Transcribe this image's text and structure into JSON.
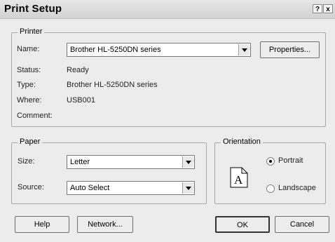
{
  "window": {
    "title": "Print Setup",
    "help_glyph": "?",
    "close_glyph": "x"
  },
  "printer": {
    "legend": "Printer",
    "name_label": "Name:",
    "name_value": "Brother HL-5250DN series",
    "properties_label": "Properties...",
    "status_label": "Status:",
    "status_value": "Ready",
    "type_label": "Type:",
    "type_value": "Brother HL-5250DN series",
    "where_label": "Where:",
    "where_value": "USB001",
    "comment_label": "Comment:",
    "comment_value": ""
  },
  "paper": {
    "legend": "Paper",
    "size_label": "Size:",
    "size_value": "Letter",
    "source_label": "Source:",
    "source_value": "Auto Select"
  },
  "orientation": {
    "legend": "Orientation",
    "page_glyph": "A",
    "portrait_label": "Portrait",
    "landscape_label": "Landscape",
    "selected": "Portrait"
  },
  "buttons": {
    "help": "Help",
    "network": "Network...",
    "ok": "OK",
    "cancel": "Cancel"
  }
}
